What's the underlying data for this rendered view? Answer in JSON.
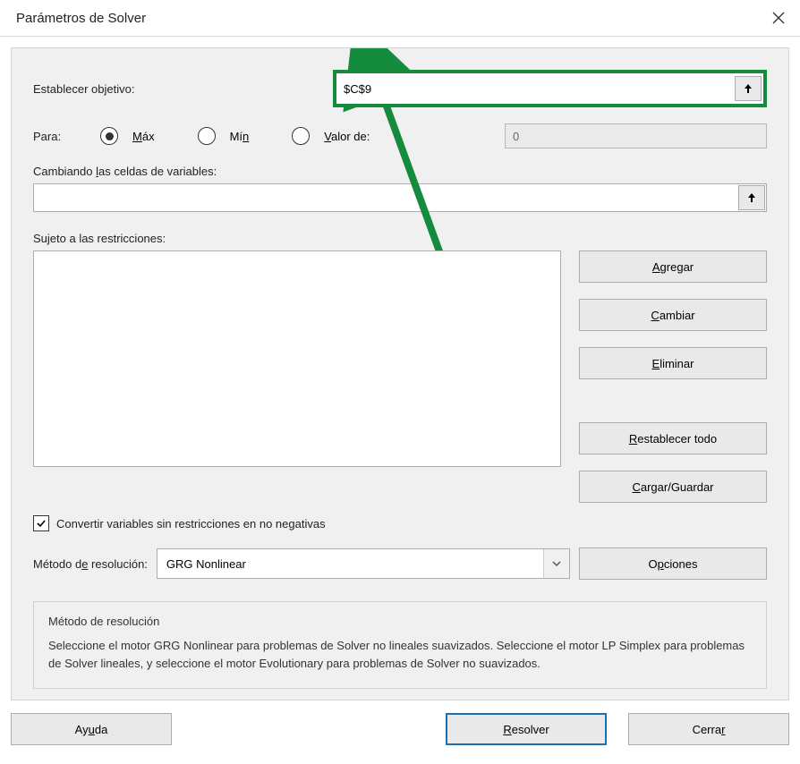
{
  "title": "Parámetros de Solver",
  "labels": {
    "objective": "Establecer objetivo:",
    "para": "Para:",
    "max": "Máx",
    "min": "Mín",
    "value_of": "Valor de:",
    "changing": "Cambiando las celdas de variables:",
    "subject": "Sujeto a las restricciones:",
    "unconstrained": "Convertir variables sin restricciones en no negativas",
    "method": "Método de resolución:"
  },
  "objective_value": "$C$9",
  "value_of_value": "0",
  "changing_value": "",
  "radio": {
    "max": true,
    "min": false,
    "value_of": false
  },
  "checkbox": {
    "unconstrained": true
  },
  "method_selected": "GRG Nonlinear",
  "buttons": {
    "add": "Agregar",
    "change": "Cambiar",
    "delete": "Eliminar",
    "reset": "Restablecer todo",
    "loadsave": "Cargar/Guardar",
    "options": "Opciones",
    "help": "Ayuda",
    "solve": "Resolver",
    "close": "Cerrar"
  },
  "info": {
    "title": "Método de resolución",
    "body": "Seleccione el motor GRG Nonlinear para problemas de Solver no lineales suavizados. Seleccione el motor LP Simplex para problemas de Solver lineales, y seleccione el motor Evolutionary para problemas de Solver no suavizados."
  }
}
